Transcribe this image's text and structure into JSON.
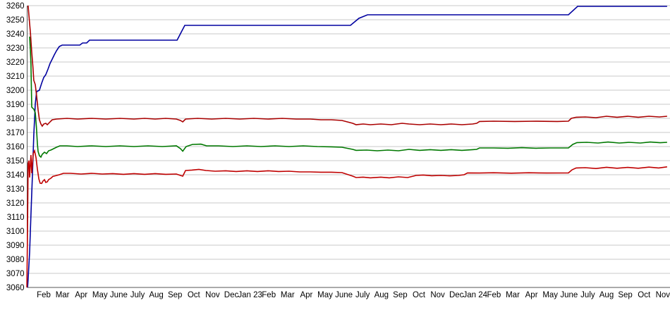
{
  "chart_data": {
    "type": "line",
    "title": "",
    "xlabel": "",
    "ylabel": "",
    "ylim": [
      3060,
      3260
    ],
    "ytick_step": 10,
    "grid": "horizontal",
    "legend": "none",
    "background": "#ffffff",
    "colors": {
      "gridline": "#c8c8c8",
      "axis": "#555555",
      "text": "#000000"
    },
    "x_axis_labels": [
      "Feb",
      "Mar",
      "Apr",
      "May",
      "June",
      "July",
      "Aug",
      "Sep",
      "Oct",
      "Nov",
      "Dec",
      "Jan 23",
      "Feb",
      "Mar",
      "Apr",
      "May",
      "June",
      "July",
      "Aug",
      "Sep",
      "Oct",
      "Nov",
      "Dec",
      "Jan 24",
      "Feb",
      "Mar",
      "Apr",
      "May",
      "June",
      "July",
      "Aug",
      "Sep",
      "Oct",
      "Nov"
    ],
    "x_unit": "month index, 0 = Feb 2022 tick, range starts early Jan 2022",
    "series": [
      {
        "name": "navy-stepped-series",
        "color": "#0000a0",
        "points": [
          [
            -0.86,
            3060
          ],
          [
            -0.83,
            3066
          ],
          [
            -0.75,
            3085
          ],
          [
            -0.68,
            3112
          ],
          [
            -0.6,
            3140
          ],
          [
            -0.53,
            3168
          ],
          [
            -0.45,
            3190
          ],
          [
            -0.38,
            3199
          ],
          [
            -0.23,
            3200
          ],
          [
            -0.11,
            3205
          ],
          [
            0.0,
            3209
          ],
          [
            0.11,
            3211
          ],
          [
            0.23,
            3215
          ],
          [
            0.34,
            3219
          ],
          [
            0.45,
            3222
          ],
          [
            0.56,
            3225
          ],
          [
            0.68,
            3228
          ],
          [
            0.83,
            3231
          ],
          [
            0.98,
            3232
          ],
          [
            1.92,
            3232
          ],
          [
            2.07,
            3233.5
          ],
          [
            2.29,
            3233.5
          ],
          [
            2.44,
            3235.5
          ],
          [
            7.11,
            3235.5
          ],
          [
            7.52,
            3246
          ],
          [
            16.35,
            3246
          ],
          [
            16.62,
            3249
          ],
          [
            16.8,
            3251
          ],
          [
            17.26,
            3253.5
          ],
          [
            27.97,
            3253.5
          ],
          [
            28.46,
            3259.5
          ],
          [
            33.23,
            3259.5
          ]
        ]
      },
      {
        "name": "dark-red-upper-series",
        "color": "#aa0000",
        "points": [
          [
            -0.83,
            3260
          ],
          [
            -0.79,
            3253
          ],
          [
            -0.71,
            3241
          ],
          [
            -0.64,
            3227
          ],
          [
            -0.58,
            3217
          ],
          [
            -0.53,
            3207
          ],
          [
            -0.45,
            3204
          ],
          [
            -0.38,
            3196
          ],
          [
            -0.3,
            3186
          ],
          [
            -0.23,
            3179
          ],
          [
            -0.15,
            3176
          ],
          [
            -0.08,
            3174.5
          ],
          [
            0.0,
            3176
          ],
          [
            0.11,
            3176.5
          ],
          [
            0.19,
            3175.5
          ],
          [
            0.3,
            3177
          ],
          [
            0.45,
            3179
          ],
          [
            0.68,
            3179.5
          ],
          [
            1.24,
            3180
          ],
          [
            1.8,
            3179.5
          ],
          [
            2.56,
            3180
          ],
          [
            3.31,
            3179.5
          ],
          [
            4.06,
            3180
          ],
          [
            4.81,
            3179.5
          ],
          [
            5.38,
            3180
          ],
          [
            5.94,
            3179.5
          ],
          [
            6.5,
            3180
          ],
          [
            7.07,
            3179.5
          ],
          [
            7.29,
            3178.5
          ],
          [
            7.41,
            3177.5
          ],
          [
            7.56,
            3179.5
          ],
          [
            8.2,
            3180
          ],
          [
            8.95,
            3179.5
          ],
          [
            9.7,
            3180
          ],
          [
            10.45,
            3179.5
          ],
          [
            11.2,
            3180
          ],
          [
            11.95,
            3179.5
          ],
          [
            12.71,
            3180
          ],
          [
            13.46,
            3179.5
          ],
          [
            14.21,
            3179.5
          ],
          [
            14.77,
            3179
          ],
          [
            15.34,
            3179
          ],
          [
            15.9,
            3178.5
          ],
          [
            16.47,
            3176.5
          ],
          [
            16.65,
            3175.5
          ],
          [
            17.03,
            3176
          ],
          [
            17.41,
            3175.5
          ],
          [
            17.97,
            3176
          ],
          [
            18.53,
            3175.5
          ],
          [
            19.1,
            3176.5
          ],
          [
            19.47,
            3176
          ],
          [
            20.04,
            3175.5
          ],
          [
            20.6,
            3176
          ],
          [
            21.17,
            3175.5
          ],
          [
            21.73,
            3176
          ],
          [
            22.29,
            3175.5
          ],
          [
            22.86,
            3176
          ],
          [
            23.08,
            3176.5
          ],
          [
            23.23,
            3177.8
          ],
          [
            23.98,
            3178
          ],
          [
            25.11,
            3177.8
          ],
          [
            26.24,
            3178
          ],
          [
            27.37,
            3177.8
          ],
          [
            27.97,
            3178
          ],
          [
            28.12,
            3180
          ],
          [
            28.38,
            3180.8
          ],
          [
            28.87,
            3181
          ],
          [
            29.44,
            3180.5
          ],
          [
            30.0,
            3181.5
          ],
          [
            30.56,
            3180.8
          ],
          [
            31.13,
            3181.5
          ],
          [
            31.69,
            3180.8
          ],
          [
            32.26,
            3181.5
          ],
          [
            32.82,
            3181
          ],
          [
            33.23,
            3181.5
          ]
        ]
      },
      {
        "name": "green-middle-series",
        "color": "#007800",
        "points": [
          [
            -0.75,
            3238
          ],
          [
            -0.71,
            3228
          ],
          [
            -0.68,
            3218
          ],
          [
            -0.64,
            3188
          ],
          [
            -0.53,
            3186.5
          ],
          [
            -0.45,
            3184
          ],
          [
            -0.39,
            3174
          ],
          [
            -0.34,
            3162
          ],
          [
            -0.3,
            3156.5
          ],
          [
            -0.23,
            3153.5
          ],
          [
            -0.15,
            3152.5
          ],
          [
            -0.08,
            3154.5
          ],
          [
            0.04,
            3156
          ],
          [
            0.15,
            3155
          ],
          [
            0.26,
            3157
          ],
          [
            0.38,
            3157.5
          ],
          [
            0.53,
            3158.5
          ],
          [
            0.68,
            3159.5
          ],
          [
            0.86,
            3160.5
          ],
          [
            1.24,
            3160.5
          ],
          [
            1.8,
            3160
          ],
          [
            2.56,
            3160.5
          ],
          [
            3.31,
            3160
          ],
          [
            4.06,
            3160.5
          ],
          [
            4.81,
            3160
          ],
          [
            5.56,
            3160.5
          ],
          [
            6.32,
            3160
          ],
          [
            7.07,
            3160.5
          ],
          [
            7.29,
            3158.5
          ],
          [
            7.41,
            3156.7
          ],
          [
            7.59,
            3160
          ],
          [
            7.93,
            3161.5
          ],
          [
            8.38,
            3161.7
          ],
          [
            8.68,
            3160.5
          ],
          [
            9.32,
            3160.5
          ],
          [
            10.08,
            3160
          ],
          [
            10.83,
            3160.5
          ],
          [
            11.58,
            3160
          ],
          [
            12.33,
            3160.5
          ],
          [
            13.08,
            3160
          ],
          [
            13.83,
            3160.5
          ],
          [
            14.59,
            3160
          ],
          [
            15.34,
            3159.8
          ],
          [
            15.9,
            3159.5
          ],
          [
            16.47,
            3158
          ],
          [
            16.65,
            3157.3
          ],
          [
            17.22,
            3157.5
          ],
          [
            17.78,
            3157
          ],
          [
            18.35,
            3157.5
          ],
          [
            18.91,
            3157
          ],
          [
            19.47,
            3158
          ],
          [
            20.04,
            3157.3
          ],
          [
            20.6,
            3157.8
          ],
          [
            21.17,
            3157.3
          ],
          [
            21.73,
            3157.8
          ],
          [
            22.29,
            3157.3
          ],
          [
            22.86,
            3157.8
          ],
          [
            23.08,
            3158
          ],
          [
            23.23,
            3159
          ],
          [
            23.98,
            3159
          ],
          [
            24.74,
            3158.8
          ],
          [
            25.49,
            3159.2
          ],
          [
            26.24,
            3158.8
          ],
          [
            26.99,
            3159
          ],
          [
            27.97,
            3159
          ],
          [
            28.2,
            3161.5
          ],
          [
            28.42,
            3162.8
          ],
          [
            28.95,
            3163
          ],
          [
            29.55,
            3162.5
          ],
          [
            30.08,
            3163.2
          ],
          [
            30.68,
            3162.5
          ],
          [
            31.2,
            3163
          ],
          [
            31.8,
            3162.5
          ],
          [
            32.33,
            3163.2
          ],
          [
            32.86,
            3162.7
          ],
          [
            33.23,
            3163
          ]
        ]
      },
      {
        "name": "red-lower-series",
        "color": "#c00000",
        "points": [
          [
            -0.9,
            3060
          ],
          [
            -0.86,
            3105
          ],
          [
            -0.83,
            3148
          ],
          [
            -0.79,
            3150
          ],
          [
            -0.75,
            3138
          ],
          [
            -0.71,
            3148
          ],
          [
            -0.68,
            3154
          ],
          [
            -0.64,
            3141
          ],
          [
            -0.6,
            3148
          ],
          [
            -0.56,
            3155
          ],
          [
            -0.49,
            3157
          ],
          [
            -0.41,
            3152
          ],
          [
            -0.34,
            3144
          ],
          [
            -0.26,
            3137
          ],
          [
            -0.19,
            3134
          ],
          [
            -0.11,
            3133.8
          ],
          [
            -0.04,
            3135.5
          ],
          [
            0.04,
            3136.5
          ],
          [
            0.11,
            3134.5
          ],
          [
            0.19,
            3135
          ],
          [
            0.26,
            3136.5
          ],
          [
            0.38,
            3137.5
          ],
          [
            0.49,
            3138.8
          ],
          [
            0.64,
            3139.3
          ],
          [
            0.83,
            3140
          ],
          [
            1.05,
            3141
          ],
          [
            1.43,
            3141
          ],
          [
            1.99,
            3140.5
          ],
          [
            2.56,
            3141
          ],
          [
            3.12,
            3140.5
          ],
          [
            3.68,
            3140.8
          ],
          [
            4.25,
            3140.3
          ],
          [
            4.81,
            3140.8
          ],
          [
            5.38,
            3140.3
          ],
          [
            5.94,
            3140.8
          ],
          [
            6.5,
            3140.3
          ],
          [
            7.07,
            3140.5
          ],
          [
            7.29,
            3139.5
          ],
          [
            7.41,
            3139
          ],
          [
            7.56,
            3143
          ],
          [
            7.89,
            3143.3
          ],
          [
            8.27,
            3143.8
          ],
          [
            8.65,
            3143
          ],
          [
            9.14,
            3142.5
          ],
          [
            9.7,
            3142.8
          ],
          [
            10.26,
            3142.3
          ],
          [
            10.83,
            3142.8
          ],
          [
            11.39,
            3142.3
          ],
          [
            11.95,
            3142.8
          ],
          [
            12.52,
            3142.3
          ],
          [
            13.08,
            3142.5
          ],
          [
            13.65,
            3142
          ],
          [
            14.21,
            3142
          ],
          [
            14.77,
            3141.8
          ],
          [
            15.34,
            3141.8
          ],
          [
            15.9,
            3141.5
          ],
          [
            16.47,
            3139
          ],
          [
            16.65,
            3138
          ],
          [
            17.03,
            3138.3
          ],
          [
            17.41,
            3137.8
          ],
          [
            17.97,
            3138.3
          ],
          [
            18.42,
            3137.8
          ],
          [
            18.91,
            3138.5
          ],
          [
            19.4,
            3138
          ],
          [
            19.85,
            3139.5
          ],
          [
            20.23,
            3139.8
          ],
          [
            20.68,
            3139.3
          ],
          [
            21.17,
            3139.5
          ],
          [
            21.65,
            3139.2
          ],
          [
            22.11,
            3139.5
          ],
          [
            22.41,
            3140
          ],
          [
            22.59,
            3141.3
          ],
          [
            23.23,
            3141.2
          ],
          [
            23.98,
            3141.4
          ],
          [
            24.92,
            3141.1
          ],
          [
            25.86,
            3141.4
          ],
          [
            26.8,
            3141.2
          ],
          [
            27.97,
            3141.3
          ],
          [
            28.16,
            3143.5
          ],
          [
            28.38,
            3144.8
          ],
          [
            28.87,
            3145
          ],
          [
            29.44,
            3144.4
          ],
          [
            30.0,
            3145.3
          ],
          [
            30.56,
            3144.6
          ],
          [
            31.13,
            3145.2
          ],
          [
            31.69,
            3144.6
          ],
          [
            32.26,
            3145.4
          ],
          [
            32.78,
            3144.8
          ],
          [
            33.23,
            3145.6
          ]
        ]
      }
    ]
  }
}
